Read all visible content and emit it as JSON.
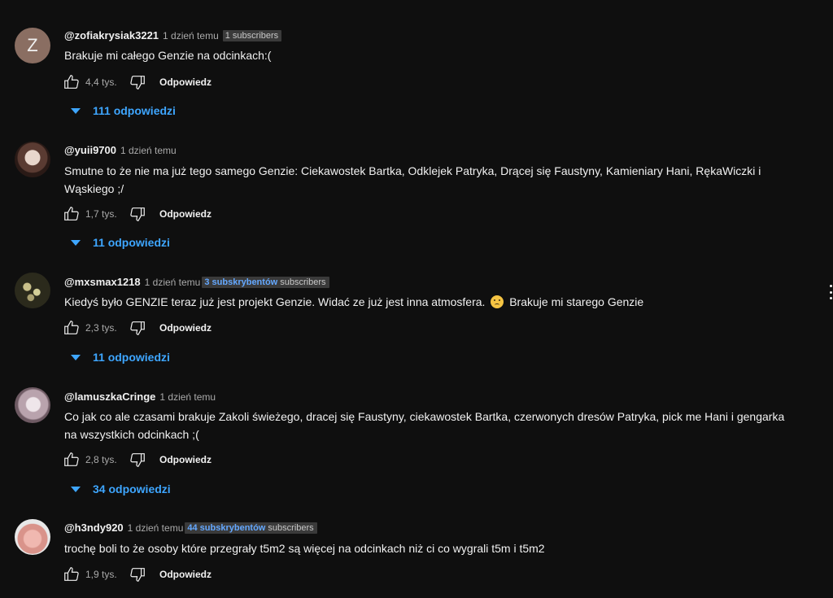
{
  "comments": [
    {
      "username": "@zofiakrysiak3221",
      "time": "1 dzień temu",
      "badge_prefix": "",
      "badge_suffix": "1 subscribers",
      "avatar_letter": "Z",
      "text": "Brakuje mi całego Genzie na odcinkach:(",
      "likes": "4,4 tys.",
      "reply_label": "Odpowiedz",
      "replies_label": "111 odpowiedzi"
    },
    {
      "username": "@yuii9700",
      "time": "1 dzień temu",
      "text": "Smutne to że nie ma już tego samego Genzie: Ciekawostek Bartka, Odklejek Patryka, Drącej się Faustyny, Kamieniary Hani, RękaWiczki i Wąskiego ;/",
      "likes": "1,7 tys.",
      "reply_label": "Odpowiedz",
      "replies_label": "11 odpowiedzi"
    },
    {
      "username": "@mxsmax1218",
      "time": "1 dzień temu",
      "badge_prefix": "3 subskrybentów",
      "badge_suffix": " subscribers",
      "text_before_emoji": "Kiedyś było GENZIE teraz już jest projekt Genzie. Widać ze już jest inna atmosfera. ",
      "text_after_emoji": " Brakuje mi starego Genzie",
      "emoji_icon": "sad-face-emoji",
      "likes": "2,3 tys.",
      "reply_label": "Odpowiedz",
      "replies_label": "11 odpowiedzi"
    },
    {
      "username": "@lamuszkaCringe",
      "time": "1 dzień temu",
      "text": "Co jak co ale czasami brakuje Zakoli świeżego, dracej się Faustyny, ciekawostek Bartka, czerwonych dresów Patryka, pick me Hani i gengarka na wszystkich odcinkach ;(",
      "likes": "2,8 tys.",
      "reply_label": "Odpowiedz",
      "replies_label": "34 odpowiedzi"
    },
    {
      "username": "@h3ndy920",
      "time": "1 dzień temu",
      "badge_prefix": "44 subskrybentów",
      "badge_suffix": " subscribers",
      "text": "trochę boli to że osoby które przegrały t5m2 są więcej na odcinkach niż ci co wygrali t5m i t5m2",
      "likes": "1,9 tys.",
      "reply_label": "Odpowiedz"
    }
  ],
  "colors": {
    "background": "#0f0f0f",
    "accent_blue": "#3ea6ff",
    "muted": "#aaaaaa"
  }
}
